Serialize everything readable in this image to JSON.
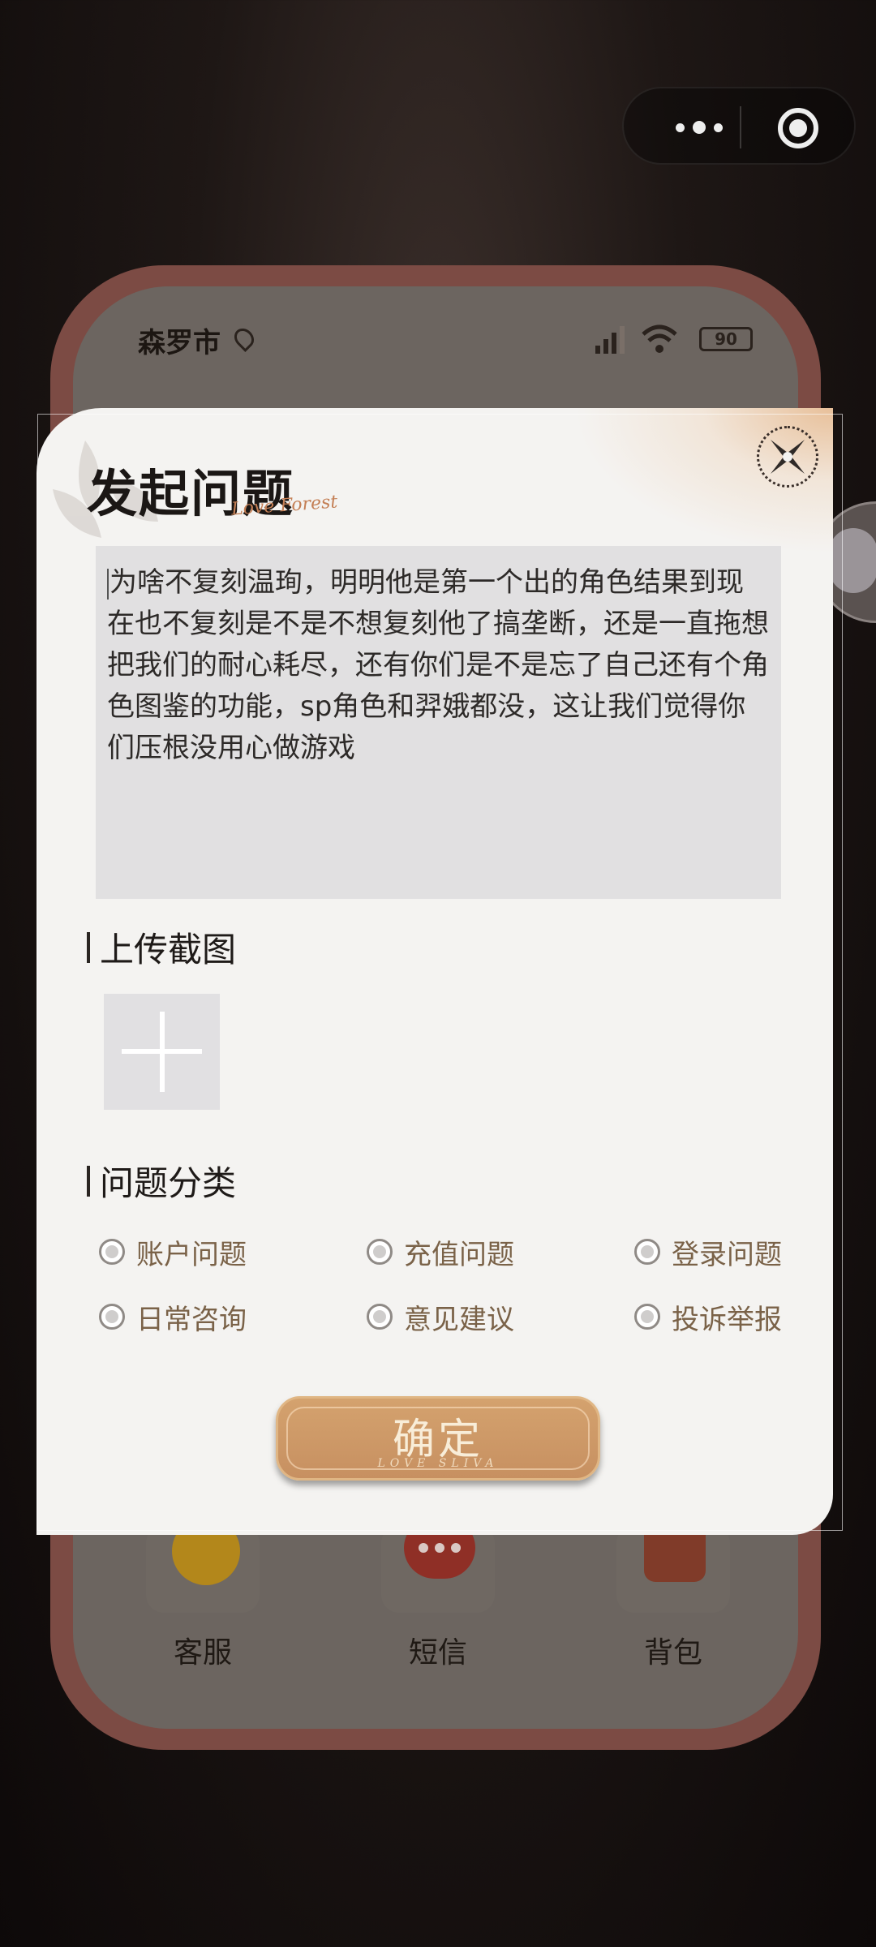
{
  "capsule": {
    "more_icon": "more-dots-icon",
    "close_icon": "target-icon"
  },
  "background_app": {
    "status": {
      "city": "森罗市",
      "battery": "90"
    },
    "dock": [
      {
        "label": "客服",
        "icon": "customer-service-icon"
      },
      {
        "label": "短信",
        "icon": "message-icon"
      },
      {
        "label": "背包",
        "icon": "bag-icon"
      }
    ]
  },
  "dialog": {
    "title": "发起问题",
    "title_script": "Love Forest",
    "close_icon": "close-icon",
    "question_text": "为啥不复刻温珣，明明他是第一个出的角色结果到现在也不复刻是不是不想复刻他了搞垄断，还是一直拖想把我们的耐心耗尽，还有你们是不是忘了自己还有个角色图鉴的功能，sp角色和羿娥都没，这让我们觉得你们压根没用心做游戏",
    "upload_section": {
      "label": "上传截图",
      "icon": "plus-icon"
    },
    "category_section": {
      "label": "问题分类",
      "options": [
        [
          "账户问题",
          "充值问题",
          "登录问题"
        ],
        [
          "日常咨询",
          "意见建议",
          "投诉举报"
        ]
      ]
    },
    "confirm": {
      "label": "确定",
      "sub": "LOVE SLIVA"
    }
  }
}
